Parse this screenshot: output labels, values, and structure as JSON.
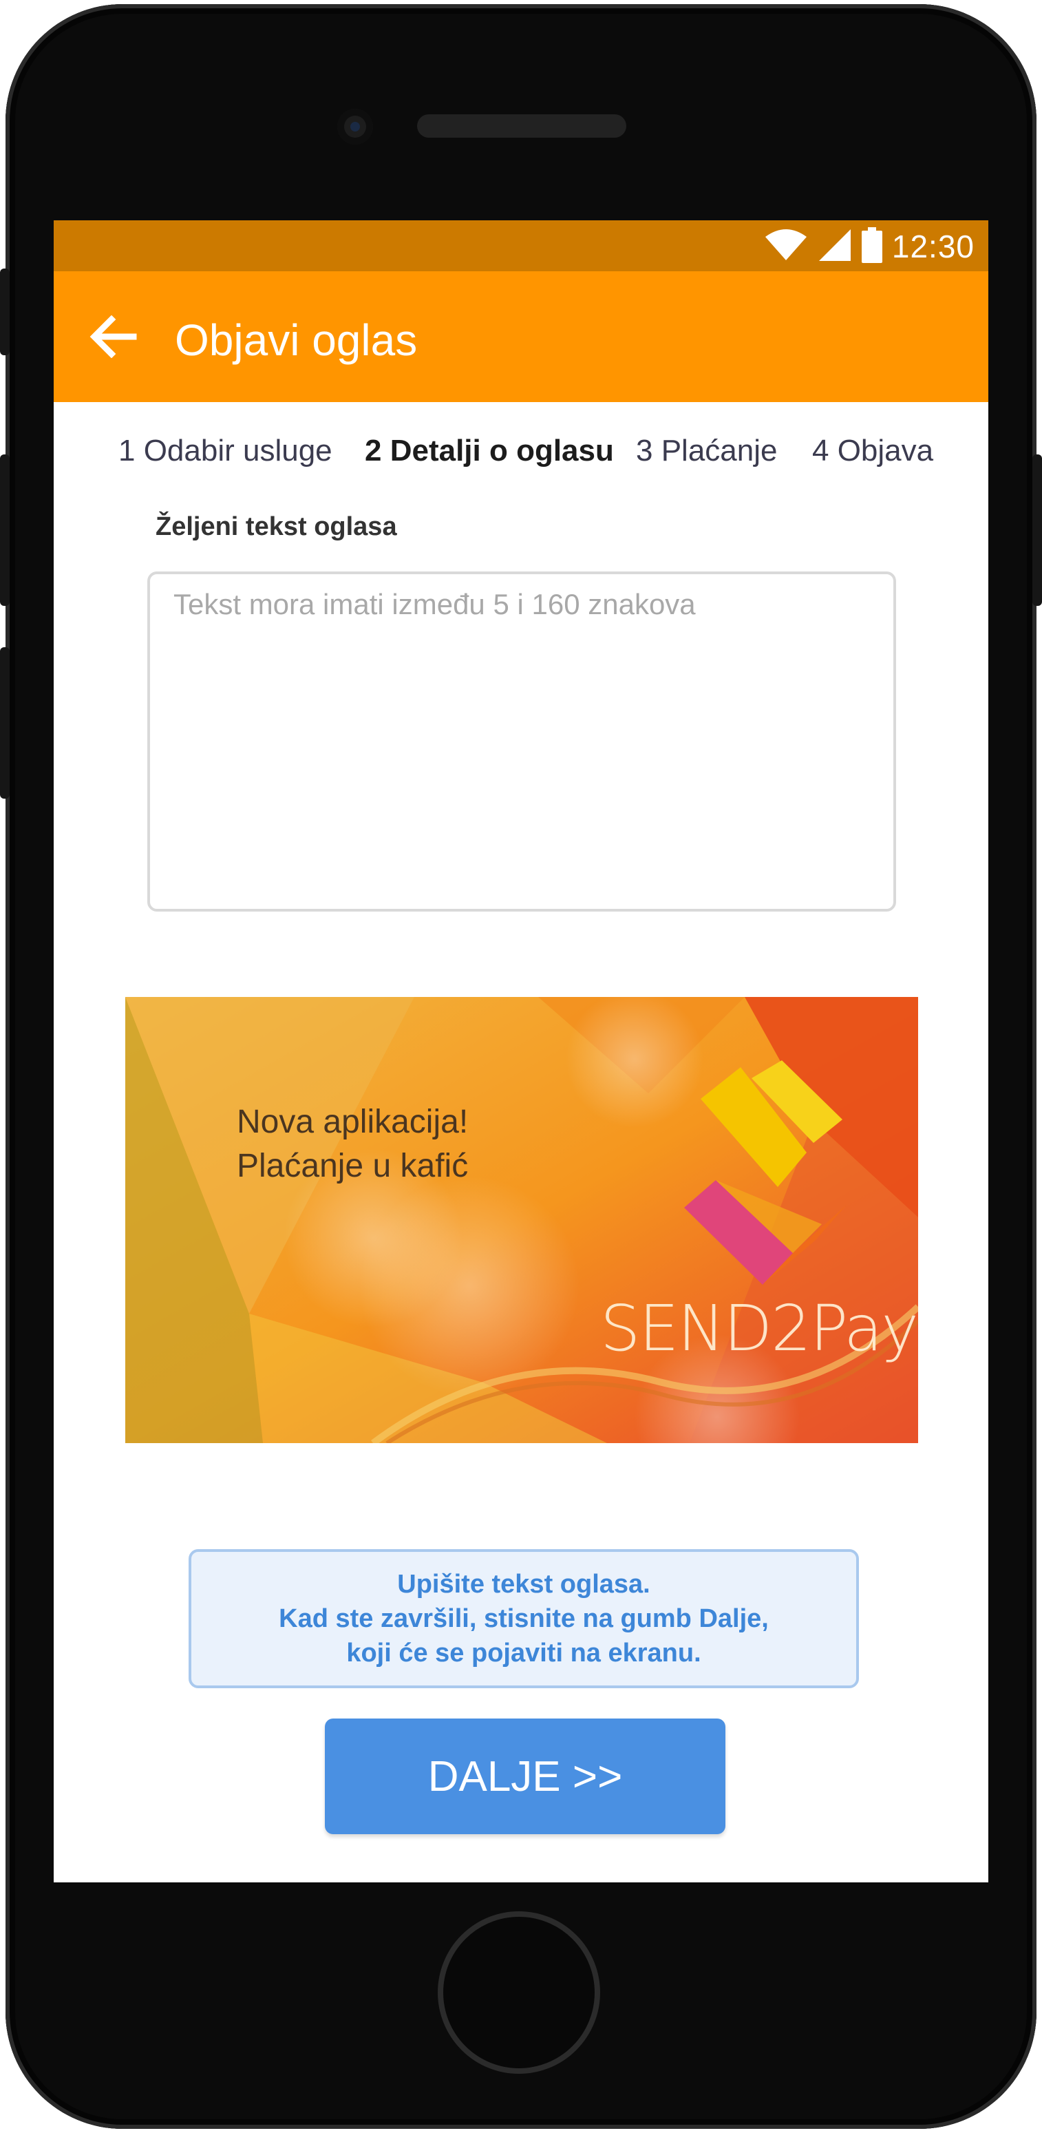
{
  "status_bar": {
    "time": "12:30",
    "icons": [
      "wifi-icon",
      "signal-icon",
      "battery-icon"
    ]
  },
  "app_bar": {
    "title": "Objavi oglas",
    "back_icon": "arrow-left-icon"
  },
  "steps": [
    {
      "label": "1 Odabir usluge",
      "active": false
    },
    {
      "label": "2 Detalji o oglasu",
      "active": true
    },
    {
      "label": "3 Plaćanje",
      "active": false
    },
    {
      "label": "4 Objava",
      "active": false
    }
  ],
  "ad_text": {
    "label": "Željeni tekst oglasa",
    "placeholder": "Tekst mora imati između 5 i 160 znakova",
    "value": ""
  },
  "banner": {
    "line1": "Nova aplikacija!",
    "line2": "Plaćanje u kafić",
    "brand": "SEND2Pay"
  },
  "info": {
    "line1": "Upišite tekst oglasa.",
    "line2": "Kad ste završili, stisnite na gumb Dalje,",
    "line3": "koji će se pojaviti na ekranu."
  },
  "next_button": {
    "label": "DALJE >>"
  },
  "colors": {
    "status_bar": "#cc7a00",
    "app_bar": "#ff9500",
    "primary_button": "#4a90e2",
    "info_text": "#3d86d8"
  }
}
